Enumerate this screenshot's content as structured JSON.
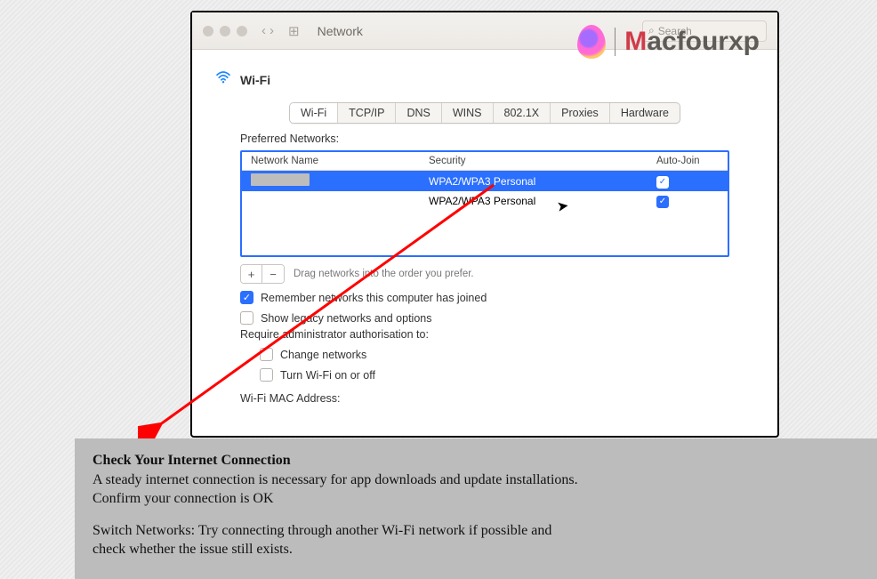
{
  "window": {
    "title": "Network",
    "search_placeholder": "Search"
  },
  "brand": {
    "m": "M",
    "rest": "acfourxp"
  },
  "section_title": "Wi-Fi",
  "tabs": [
    "Wi-Fi",
    "TCP/IP",
    "DNS",
    "WINS",
    "802.1X",
    "Proxies",
    "Hardware"
  ],
  "table": {
    "label": "Preferred Networks:",
    "headers": {
      "name": "Network Name",
      "security": "Security",
      "auto": "Auto-Join"
    },
    "rows": [
      {
        "name": "",
        "security": "WPA2/WPA3 Personal",
        "auto": true,
        "selected": true
      },
      {
        "name": "",
        "security": "WPA2/WPA3 Personal",
        "auto": true,
        "selected": false
      }
    ],
    "drag_hint": "Drag networks into the order you prefer."
  },
  "plus": "+",
  "minus": "−",
  "options": {
    "remember": {
      "label": "Remember networks this computer has joined",
      "checked": true
    },
    "legacy": {
      "label": "Show legacy networks and options",
      "checked": false
    },
    "admin_label": "Require administrator authorisation to:",
    "change": {
      "label": "Change networks",
      "checked": false
    },
    "turn": {
      "label": "Turn Wi-Fi on or off",
      "checked": false
    }
  },
  "mac_label": "Wi-Fi MAC Address:",
  "caption": {
    "h1": "Check Your Internet Connection",
    "l1": "A steady internet connection is necessary for app downloads and update installations.",
    "l2": "Confirm your connection is OK",
    "l3": "Switch Networks: Try connecting through another Wi-Fi network if possible and",
    "l4": "check whether the issue still exists."
  }
}
